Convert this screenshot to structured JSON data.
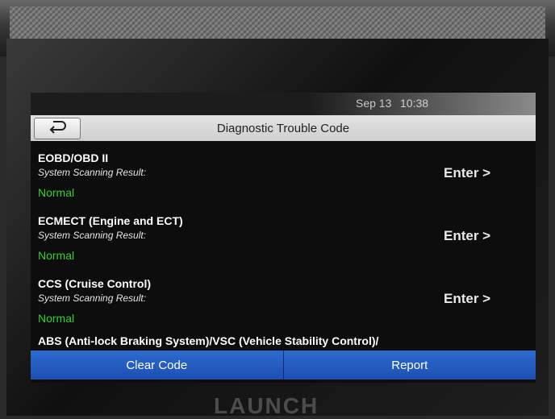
{
  "status_bar": {
    "date": "Sep 13",
    "time": "10:38"
  },
  "header": {
    "title": "Diagnostic Trouble Code",
    "back_icon": "back-arrow-icon"
  },
  "modules": [
    {
      "name": "EOBD/OBD II",
      "result_label": "System Scanning Result:",
      "result": "Normal",
      "enter_label": "Enter >"
    },
    {
      "name": "ECMECT (Engine and ECT)",
      "result_label": "System Scanning Result:",
      "result": "Normal",
      "enter_label": "Enter >"
    },
    {
      "name": "CCS (Cruise Control)",
      "result_label": "System Scanning Result:",
      "result": "Normal",
      "enter_label": "Enter >"
    },
    {
      "name": "ABS (Anti-lock Braking System)/VSC (Vehicle Stability Control)/"
    }
  ],
  "actions": {
    "clear_code_label": "Clear Code",
    "report_label": "Report"
  },
  "device": {
    "brand": "LAUNCH"
  },
  "colors": {
    "normal_status": "#34d12c",
    "action_button": "#2d6ad0",
    "title_bar": "#d9d9d9"
  }
}
